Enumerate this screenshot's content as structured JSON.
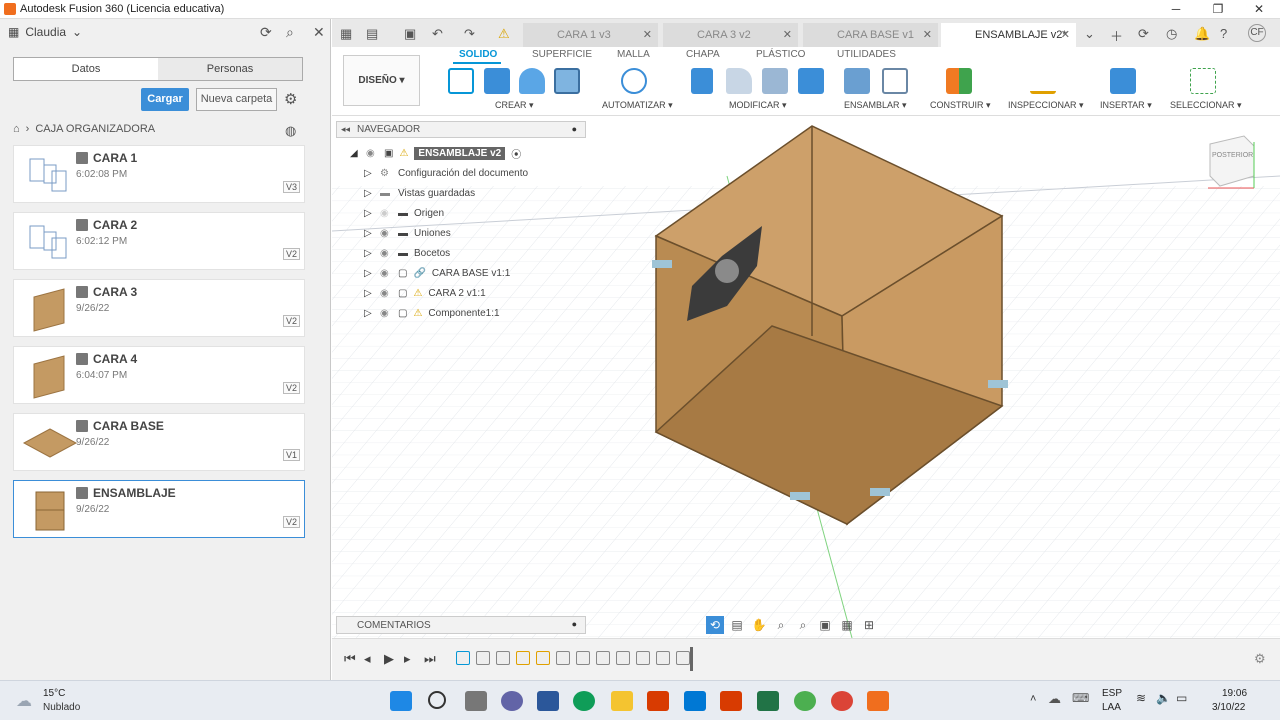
{
  "window": {
    "title": "Autodesk Fusion 360 (Licencia educativa)"
  },
  "left_panel": {
    "user": "Claudia",
    "tabs": [
      "Datos",
      "Personas"
    ],
    "upload_label": "Cargar",
    "new_folder_label": "Nueva carpeta",
    "breadcrumb": "CAJA ORGANIZADORA",
    "files": [
      {
        "name": "CARA 1",
        "date": "6:02:08 PM",
        "version": "V3"
      },
      {
        "name": "CARA 2",
        "date": "6:02:12 PM",
        "version": "V2"
      },
      {
        "name": "CARA 3",
        "date": "9/26/22",
        "version": "V2"
      },
      {
        "name": "CARA 4",
        "date": "6:04:07 PM",
        "version": "V2"
      },
      {
        "name": "CARA BASE",
        "date": "9/26/22",
        "version": "V1"
      },
      {
        "name": "ENSAMBLAJE",
        "date": "9/26/22",
        "version": "V2"
      }
    ]
  },
  "doc_tabs": [
    {
      "label": "CARA 1 v3",
      "active": false
    },
    {
      "label": "CARA 3 v2",
      "active": false
    },
    {
      "label": "CARA BASE v1",
      "active": false
    },
    {
      "label": "ENSAMBLAJE v2*",
      "active": true
    }
  ],
  "toolbar": {
    "workspace": "DISEÑO",
    "tabs": [
      "SOLIDO",
      "SUPERFICIE",
      "MALLA",
      "CHAPA",
      "PLÁSTICO",
      "UTILIDADES"
    ],
    "active_tab": "SOLIDO",
    "groups": [
      "CREAR",
      "AUTOMATIZAR",
      "MODIFICAR",
      "ENSAMBLAR",
      "CONSTRUIR",
      "INSPECCIONAR",
      "INSERTAR",
      "SELECCIONAR"
    ]
  },
  "browser": {
    "header": "NAVEGADOR",
    "root": "ENSAMBLAJE v2",
    "items": [
      "Configuración del documento",
      "Vistas guardadas",
      "Origen",
      "Uniones",
      "Bocetos",
      "CARA BASE v1:1",
      "CARA 2 v1:1",
      "Componente1:1"
    ]
  },
  "comments": {
    "header": "COMENTARIOS"
  },
  "viewcube": {
    "label": "POSTERIOR"
  },
  "taskbar": {
    "weather_temp": "15°C",
    "weather_desc": "Nublado",
    "lang1": "ESP",
    "lang2": "LAA",
    "time": "19:06",
    "date": "3/10/22"
  },
  "colors": {
    "accent": "#0696d7",
    "upload": "#3b8ed8",
    "wood": "#b98b52"
  }
}
